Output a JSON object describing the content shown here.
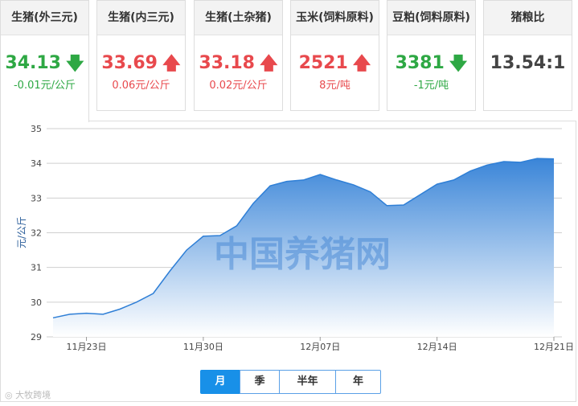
{
  "cards": [
    {
      "title": "生猪(外三元)",
      "value": "34.13",
      "change": "-0.01元/公斤",
      "trend": "down"
    },
    {
      "title": "生猪(内三元)",
      "value": "33.69",
      "change": "0.06元/公斤",
      "trend": "up"
    },
    {
      "title": "生猪(土杂猪)",
      "value": "33.18",
      "change": "0.02元/公斤",
      "trend": "up"
    },
    {
      "title": "玉米(饲料原料)",
      "value": "2521",
      "change": "8元/吨",
      "trend": "up"
    },
    {
      "title": "豆粕(饲料原料)",
      "value": "3381",
      "change": "-1元/吨",
      "trend": "down"
    },
    {
      "title": "猪粮比",
      "value": "13.54:1",
      "change": "",
      "trend": "none"
    }
  ],
  "arrows": {
    "up": "🡅",
    "down": "🡇"
  },
  "colors": {
    "up": "#e8494d",
    "down": "#2ea844",
    "accent": "#1890e8",
    "area_top": "#3a85d8",
    "area_bottom": "#ffffff",
    "line": "#2f7fd6",
    "watermark": "#3a7fd0"
  },
  "range_buttons": [
    {
      "label": "月",
      "active": true
    },
    {
      "label": "季",
      "active": false
    },
    {
      "label": "半年",
      "active": false
    },
    {
      "label": "年",
      "active": false
    }
  ],
  "source_note": "大牧跨境",
  "chart_data": {
    "type": "area",
    "title": "",
    "xlabel": "",
    "ylabel": "元/公斤",
    "ylim": [
      29,
      35
    ],
    "yticks": [
      29,
      30,
      31,
      32,
      33,
      34,
      35
    ],
    "xlim": [
      "2019-11-21",
      "2019-12-21"
    ],
    "xticks": [
      {
        "date": "2019-11-23",
        "label": "11月23日"
      },
      {
        "date": "2019-11-30",
        "label": "11月30日"
      },
      {
        "date": "2019-12-07",
        "label": "12月07日"
      },
      {
        "date": "2019-12-14",
        "label": "12月14日"
      },
      {
        "date": "2019-12-21",
        "label": "12月21日"
      }
    ],
    "grid": true,
    "watermark": "中国养猪网",
    "series": [
      {
        "name": "",
        "points": [
          {
            "x": "2019-11-21",
            "y": 29.55
          },
          {
            "x": "2019-11-22",
            "y": 29.65
          },
          {
            "x": "2019-11-23",
            "y": 29.68
          },
          {
            "x": "2019-11-24",
            "y": 29.65
          },
          {
            "x": "2019-11-25",
            "y": 29.8
          },
          {
            "x": "2019-11-26",
            "y": 30.0
          },
          {
            "x": "2019-11-27",
            "y": 30.25
          },
          {
            "x": "2019-11-28",
            "y": 30.9
          },
          {
            "x": "2019-11-29",
            "y": 31.5
          },
          {
            "x": "2019-11-30",
            "y": 31.9
          },
          {
            "x": "2019-12-01",
            "y": 31.92
          },
          {
            "x": "2019-12-02",
            "y": 32.2
          },
          {
            "x": "2019-12-03",
            "y": 32.85
          },
          {
            "x": "2019-12-04",
            "y": 33.35
          },
          {
            "x": "2019-12-05",
            "y": 33.48
          },
          {
            "x": "2019-12-06",
            "y": 33.52
          },
          {
            "x": "2019-12-07",
            "y": 33.68
          },
          {
            "x": "2019-12-08",
            "y": 33.52
          },
          {
            "x": "2019-12-09",
            "y": 33.38
          },
          {
            "x": "2019-12-10",
            "y": 33.18
          },
          {
            "x": "2019-12-11",
            "y": 32.78
          },
          {
            "x": "2019-12-12",
            "y": 32.8
          },
          {
            "x": "2019-12-13",
            "y": 33.1
          },
          {
            "x": "2019-12-14",
            "y": 33.4
          },
          {
            "x": "2019-12-15",
            "y": 33.52
          },
          {
            "x": "2019-12-16",
            "y": 33.78
          },
          {
            "x": "2019-12-17",
            "y": 33.95
          },
          {
            "x": "2019-12-18",
            "y": 34.05
          },
          {
            "x": "2019-12-19",
            "y": 34.03
          },
          {
            "x": "2019-12-20",
            "y": 34.14
          },
          {
            "x": "2019-12-21",
            "y": 34.13
          }
        ]
      }
    ]
  }
}
